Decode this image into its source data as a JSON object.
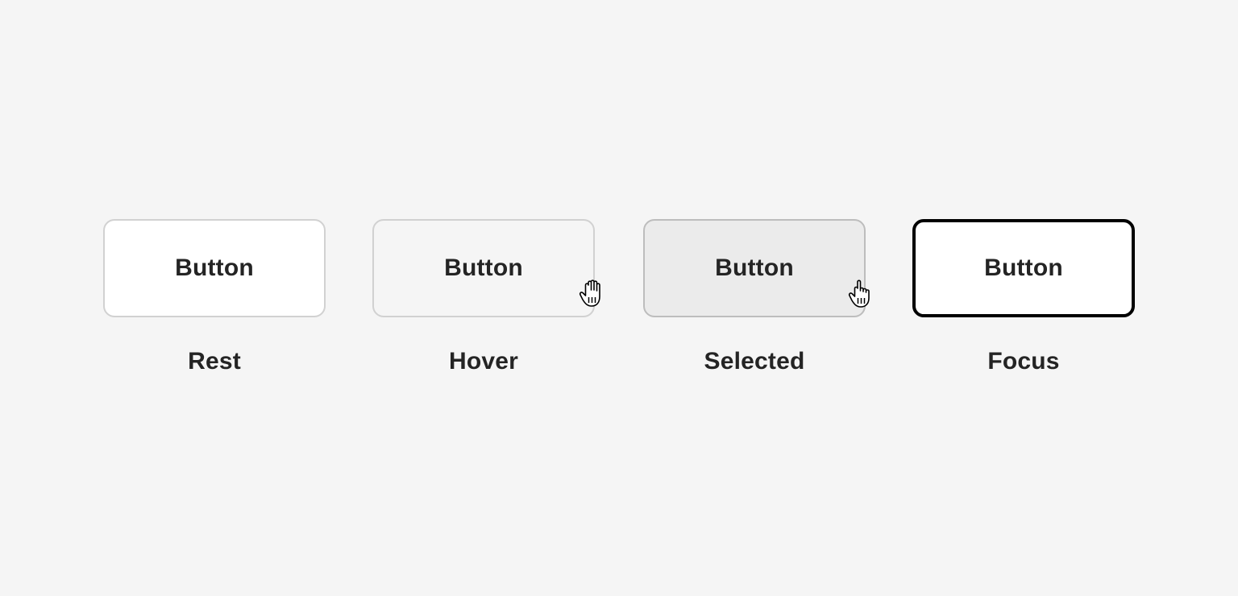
{
  "states": [
    {
      "key": "rest",
      "button_label": "Button",
      "state_label": "Rest"
    },
    {
      "key": "hover",
      "button_label": "Button",
      "state_label": "Hover"
    },
    {
      "key": "selected",
      "button_label": "Button",
      "state_label": "Selected"
    },
    {
      "key": "focus",
      "button_label": "Button",
      "state_label": "Focus"
    }
  ],
  "cursor_icon": "hand-pointer-icon",
  "colors": {
    "background": "#f5f5f5",
    "rest_fill": "#ffffff",
    "hover_fill": "#f5f5f5",
    "selected_fill": "#ebebeb",
    "focus_border": "#000000",
    "text": "#242424"
  }
}
